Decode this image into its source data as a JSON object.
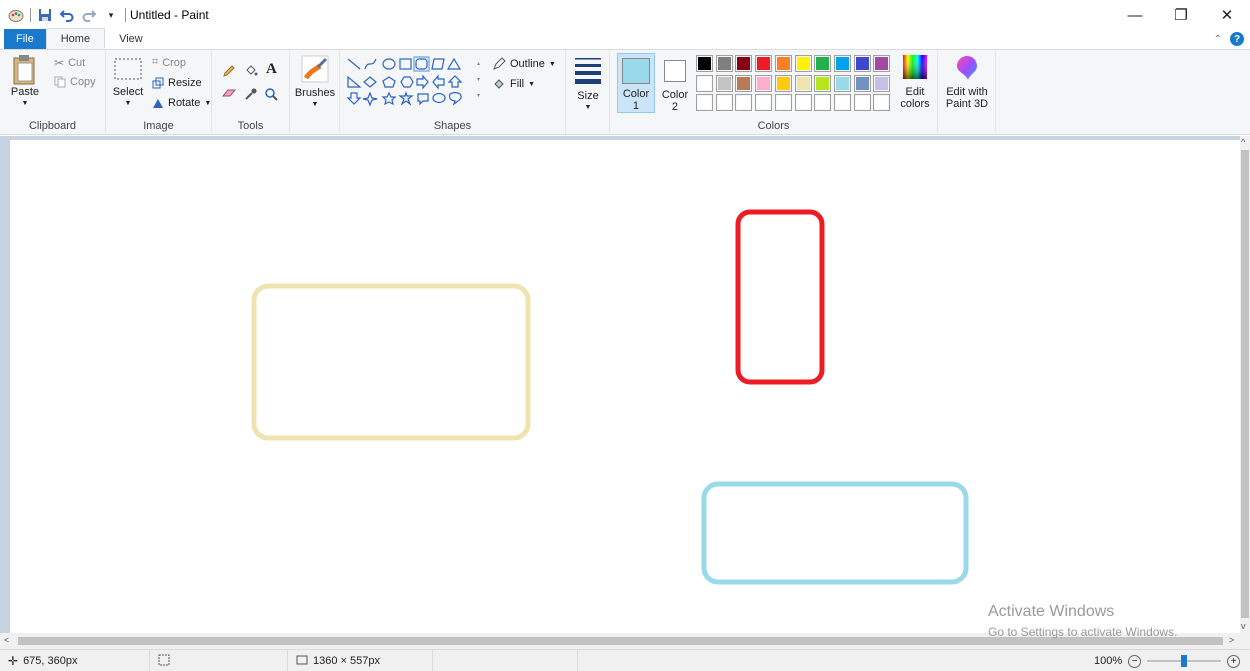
{
  "window": {
    "title": "Untitled - Paint",
    "controls": {
      "minimize": "—",
      "restore": "❐",
      "close": "✕"
    }
  },
  "tabs": [
    {
      "label": "File"
    },
    {
      "label": "Home"
    },
    {
      "label": "View"
    }
  ],
  "ribbon": {
    "clipboard": {
      "label": "Clipboard",
      "paste": "Paste",
      "cut": "Cut",
      "copy": "Copy"
    },
    "image": {
      "label": "Image",
      "select": "Select",
      "crop": "Crop",
      "resize": "Resize",
      "rotate": "Rotate"
    },
    "tools": {
      "label": "Tools"
    },
    "brushes": {
      "label": "Brushes"
    },
    "shapes": {
      "label": "Shapes",
      "outline": "Outline",
      "fill": "Fill"
    },
    "size": {
      "label": "Size"
    },
    "colors": {
      "label": "Colors",
      "color1": "Color\n1",
      "color2": "Color\n2",
      "color1_value": "#99d9ea",
      "color2_value": "#ffffff",
      "edit_colors": "Edit\ncolors",
      "palette_row1": [
        "#000000",
        "#7f7f7f",
        "#880015",
        "#ed1c24",
        "#ff7f27",
        "#fff200",
        "#22b14c",
        "#00a2e8",
        "#3f48cc",
        "#a349a4"
      ],
      "palette_row2": [
        "#ffffff",
        "#c3c3c3",
        "#b97a57",
        "#ffaec9",
        "#ffc90e",
        "#efe4b0",
        "#b5e61d",
        "#99d9ea",
        "#7092be",
        "#c8bfe7"
      ],
      "palette_row3": [
        "#ffffff",
        "#ffffff",
        "#ffffff",
        "#ffffff",
        "#ffffff",
        "#ffffff",
        "#ffffff",
        "#ffffff",
        "#ffffff",
        "#ffffff"
      ]
    },
    "paint3d": {
      "label": "Edit with\nPaint 3D"
    }
  },
  "canvas": {
    "shapes": [
      {
        "type": "rounded-rectangle",
        "stroke": "#efe4b0"
      },
      {
        "type": "rounded-rectangle",
        "stroke": "#ed1c24"
      },
      {
        "type": "rounded-rectangle",
        "stroke": "#99d9ea"
      }
    ]
  },
  "watermark": {
    "line1": "Activate Windows",
    "line2": "Go to Settings to activate Windows."
  },
  "status": {
    "cursor_pos": "675, 360px",
    "selection_size": "",
    "image_size": "1360 × 557px",
    "zoom": "100%"
  }
}
